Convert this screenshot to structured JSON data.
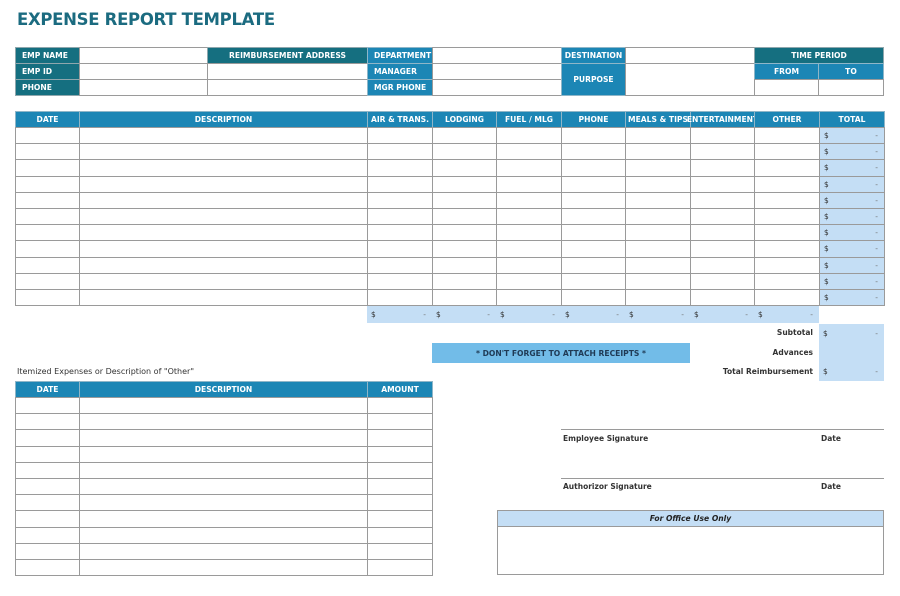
{
  "title": "EXPENSE REPORT TEMPLATE",
  "header": {
    "emp_name_label": "EMP NAME",
    "emp_id_label": "EMP ID",
    "phone_label": "PHONE",
    "reimbursement_address_label": "REIMBURSEMENT ADDRESS",
    "department_label": "DEPARTMENT",
    "manager_label": "MANAGER",
    "mgr_phone_label": "MGR PHONE",
    "destination_label": "DESTINATION",
    "purpose_label": "PURPOSE",
    "time_period_label": "TIME PERIOD",
    "from_label": "FROM",
    "to_label": "TO",
    "values": {
      "emp_name": "",
      "emp_id": "",
      "phone": "",
      "address_line1": "",
      "address_line2": "",
      "department": "",
      "manager": "",
      "mgr_phone": "",
      "destination": "",
      "purpose": "",
      "from": "",
      "to": ""
    }
  },
  "expenses": {
    "columns": [
      "DATE",
      "DESCRIPTION",
      "AIR & TRANS.",
      "LODGING",
      "FUEL / MLG",
      "PHONE",
      "MEALS & TIPS",
      "ENTERTAINMENT",
      "OTHER",
      "TOTAL"
    ],
    "row_count": 11,
    "row_total_currency": "$",
    "row_total_value": "-",
    "column_totals": [
      {
        "currency": "$",
        "value": "-"
      },
      {
        "currency": "$",
        "value": "-"
      },
      {
        "currency": "$",
        "value": "-"
      },
      {
        "currency": "$",
        "value": "-"
      },
      {
        "currency": "$",
        "value": "-"
      },
      {
        "currency": "$",
        "value": "-"
      },
      {
        "currency": "$",
        "value": "-"
      }
    ]
  },
  "summary": {
    "subtotal_label": "Subtotal",
    "subtotal_currency": "$",
    "subtotal_value": "-",
    "advances_label": "Advances",
    "advances_value": "",
    "total_reimbursement_label": "Total Reimbursement",
    "total_currency": "$",
    "total_value": "-"
  },
  "receipts_reminder": "* DON'T FORGET TO ATTACH RECEIPTS *",
  "itemized": {
    "caption": "Itemized Expenses or Description of \"Other\"",
    "columns": [
      "DATE",
      "DESCRIPTION",
      "AMOUNT"
    ],
    "row_count": 11
  },
  "signatures": {
    "employee_label": "Employee Signature",
    "employee_date_label": "Date",
    "authorizor_label": "Authorizor Signature",
    "authorizor_date_label": "Date"
  },
  "office_use": {
    "label": "For Office Use Only"
  },
  "colors": {
    "dark_teal": "#156f80",
    "header_blue": "#1c86b5",
    "light_blue_fill": "#c4def5",
    "reminder_blue": "#72bce8",
    "title_teal": "#1b6b80"
  }
}
